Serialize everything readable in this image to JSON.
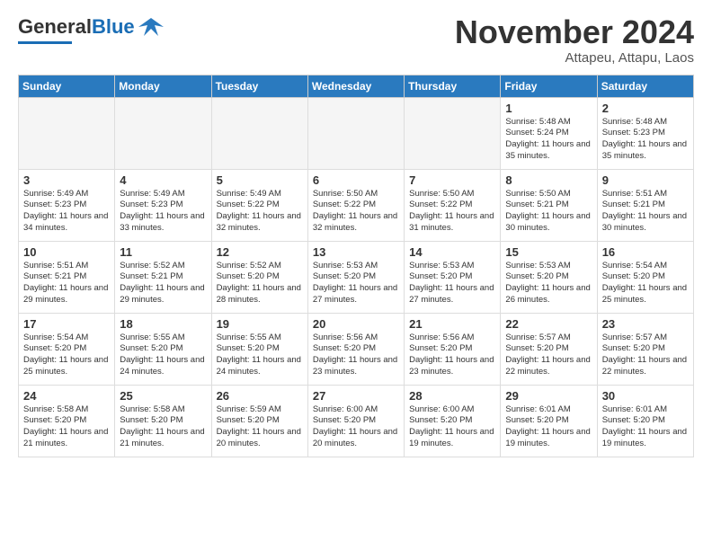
{
  "header": {
    "logo_general": "General",
    "logo_blue": "Blue",
    "month": "November 2024",
    "location": "Attapeu, Attapu, Laos"
  },
  "days_of_week": [
    "Sunday",
    "Monday",
    "Tuesday",
    "Wednesday",
    "Thursday",
    "Friday",
    "Saturday"
  ],
  "weeks": [
    [
      {
        "day": "",
        "empty": true
      },
      {
        "day": "",
        "empty": true
      },
      {
        "day": "",
        "empty": true
      },
      {
        "day": "",
        "empty": true
      },
      {
        "day": "",
        "empty": true
      },
      {
        "day": "1",
        "info": "Sunrise: 5:48 AM\nSunset: 5:24 PM\nDaylight: 11 hours\nand 35 minutes."
      },
      {
        "day": "2",
        "info": "Sunrise: 5:48 AM\nSunset: 5:23 PM\nDaylight: 11 hours\nand 35 minutes."
      }
    ],
    [
      {
        "day": "3",
        "info": "Sunrise: 5:49 AM\nSunset: 5:23 PM\nDaylight: 11 hours\nand 34 minutes."
      },
      {
        "day": "4",
        "info": "Sunrise: 5:49 AM\nSunset: 5:23 PM\nDaylight: 11 hours\nand 33 minutes."
      },
      {
        "day": "5",
        "info": "Sunrise: 5:49 AM\nSunset: 5:22 PM\nDaylight: 11 hours\nand 32 minutes."
      },
      {
        "day": "6",
        "info": "Sunrise: 5:50 AM\nSunset: 5:22 PM\nDaylight: 11 hours\nand 32 minutes."
      },
      {
        "day": "7",
        "info": "Sunrise: 5:50 AM\nSunset: 5:22 PM\nDaylight: 11 hours\nand 31 minutes."
      },
      {
        "day": "8",
        "info": "Sunrise: 5:50 AM\nSunset: 5:21 PM\nDaylight: 11 hours\nand 30 minutes."
      },
      {
        "day": "9",
        "info": "Sunrise: 5:51 AM\nSunset: 5:21 PM\nDaylight: 11 hours\nand 30 minutes."
      }
    ],
    [
      {
        "day": "10",
        "info": "Sunrise: 5:51 AM\nSunset: 5:21 PM\nDaylight: 11 hours\nand 29 minutes."
      },
      {
        "day": "11",
        "info": "Sunrise: 5:52 AM\nSunset: 5:21 PM\nDaylight: 11 hours\nand 29 minutes."
      },
      {
        "day": "12",
        "info": "Sunrise: 5:52 AM\nSunset: 5:20 PM\nDaylight: 11 hours\nand 28 minutes."
      },
      {
        "day": "13",
        "info": "Sunrise: 5:53 AM\nSunset: 5:20 PM\nDaylight: 11 hours\nand 27 minutes."
      },
      {
        "day": "14",
        "info": "Sunrise: 5:53 AM\nSunset: 5:20 PM\nDaylight: 11 hours\nand 27 minutes."
      },
      {
        "day": "15",
        "info": "Sunrise: 5:53 AM\nSunset: 5:20 PM\nDaylight: 11 hours\nand 26 minutes."
      },
      {
        "day": "16",
        "info": "Sunrise: 5:54 AM\nSunset: 5:20 PM\nDaylight: 11 hours\nand 25 minutes."
      }
    ],
    [
      {
        "day": "17",
        "info": "Sunrise: 5:54 AM\nSunset: 5:20 PM\nDaylight: 11 hours\nand 25 minutes."
      },
      {
        "day": "18",
        "info": "Sunrise: 5:55 AM\nSunset: 5:20 PM\nDaylight: 11 hours\nand 24 minutes."
      },
      {
        "day": "19",
        "info": "Sunrise: 5:55 AM\nSunset: 5:20 PM\nDaylight: 11 hours\nand 24 minutes."
      },
      {
        "day": "20",
        "info": "Sunrise: 5:56 AM\nSunset: 5:20 PM\nDaylight: 11 hours\nand 23 minutes."
      },
      {
        "day": "21",
        "info": "Sunrise: 5:56 AM\nSunset: 5:20 PM\nDaylight: 11 hours\nand 23 minutes."
      },
      {
        "day": "22",
        "info": "Sunrise: 5:57 AM\nSunset: 5:20 PM\nDaylight: 11 hours\nand 22 minutes."
      },
      {
        "day": "23",
        "info": "Sunrise: 5:57 AM\nSunset: 5:20 PM\nDaylight: 11 hours\nand 22 minutes."
      }
    ],
    [
      {
        "day": "24",
        "info": "Sunrise: 5:58 AM\nSunset: 5:20 PM\nDaylight: 11 hours\nand 21 minutes."
      },
      {
        "day": "25",
        "info": "Sunrise: 5:58 AM\nSunset: 5:20 PM\nDaylight: 11 hours\nand 21 minutes."
      },
      {
        "day": "26",
        "info": "Sunrise: 5:59 AM\nSunset: 5:20 PM\nDaylight: 11 hours\nand 20 minutes."
      },
      {
        "day": "27",
        "info": "Sunrise: 6:00 AM\nSunset: 5:20 PM\nDaylight: 11 hours\nand 20 minutes."
      },
      {
        "day": "28",
        "info": "Sunrise: 6:00 AM\nSunset: 5:20 PM\nDaylight: 11 hours\nand 19 minutes."
      },
      {
        "day": "29",
        "info": "Sunrise: 6:01 AM\nSunset: 5:20 PM\nDaylight: 11 hours\nand 19 minutes."
      },
      {
        "day": "30",
        "info": "Sunrise: 6:01 AM\nSunset: 5:20 PM\nDaylight: 11 hours\nand 19 minutes."
      }
    ]
  ]
}
